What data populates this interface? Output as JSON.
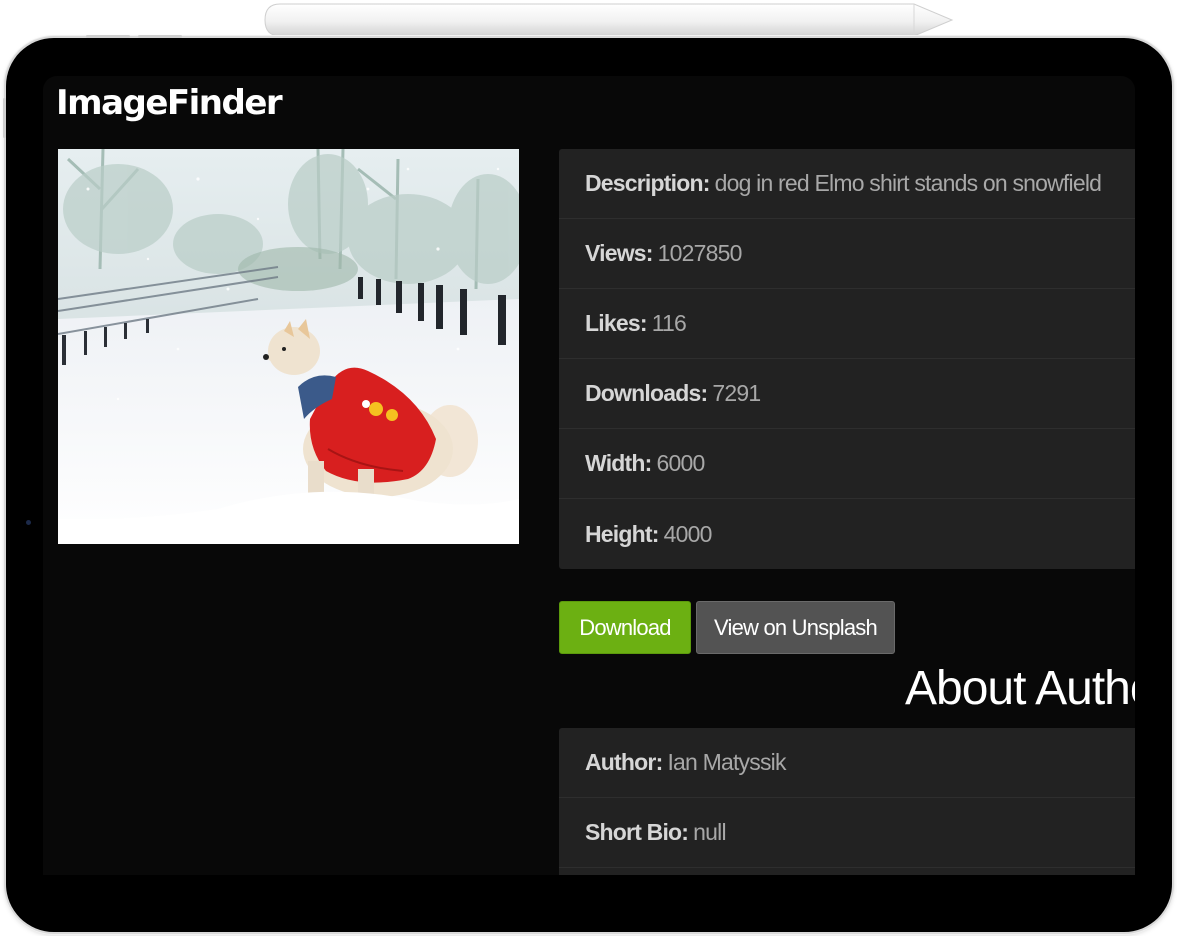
{
  "app": {
    "title": "ImageFinder"
  },
  "photo": {
    "alt": "dog in red Elmo shirt stands on snowfield"
  },
  "details": [
    {
      "label": "Description:",
      "value": "dog in red Elmo shirt stands on snowfield"
    },
    {
      "label": "Views:",
      "value": "1027850"
    },
    {
      "label": "Likes:",
      "value": "116"
    },
    {
      "label": "Downloads:",
      "value": "7291"
    },
    {
      "label": "Width:",
      "value": "6000"
    },
    {
      "label": "Height:",
      "value": "4000"
    }
  ],
  "actions": {
    "download_label": "Download",
    "unsplash_label": "View on Unsplash"
  },
  "author_section": {
    "title": "About Author",
    "rows": [
      {
        "label": "Author:",
        "value": "Ian Matyssik"
      },
      {
        "label": "Short Bio:",
        "value": "null"
      }
    ]
  },
  "colors": {
    "screen_bg": "#080808",
    "panel_bg": "#222222",
    "download_button": "#6cb012",
    "unsplash_button": "#535353"
  },
  "icons": [
    "stylus-pencil",
    "front-camera"
  ]
}
